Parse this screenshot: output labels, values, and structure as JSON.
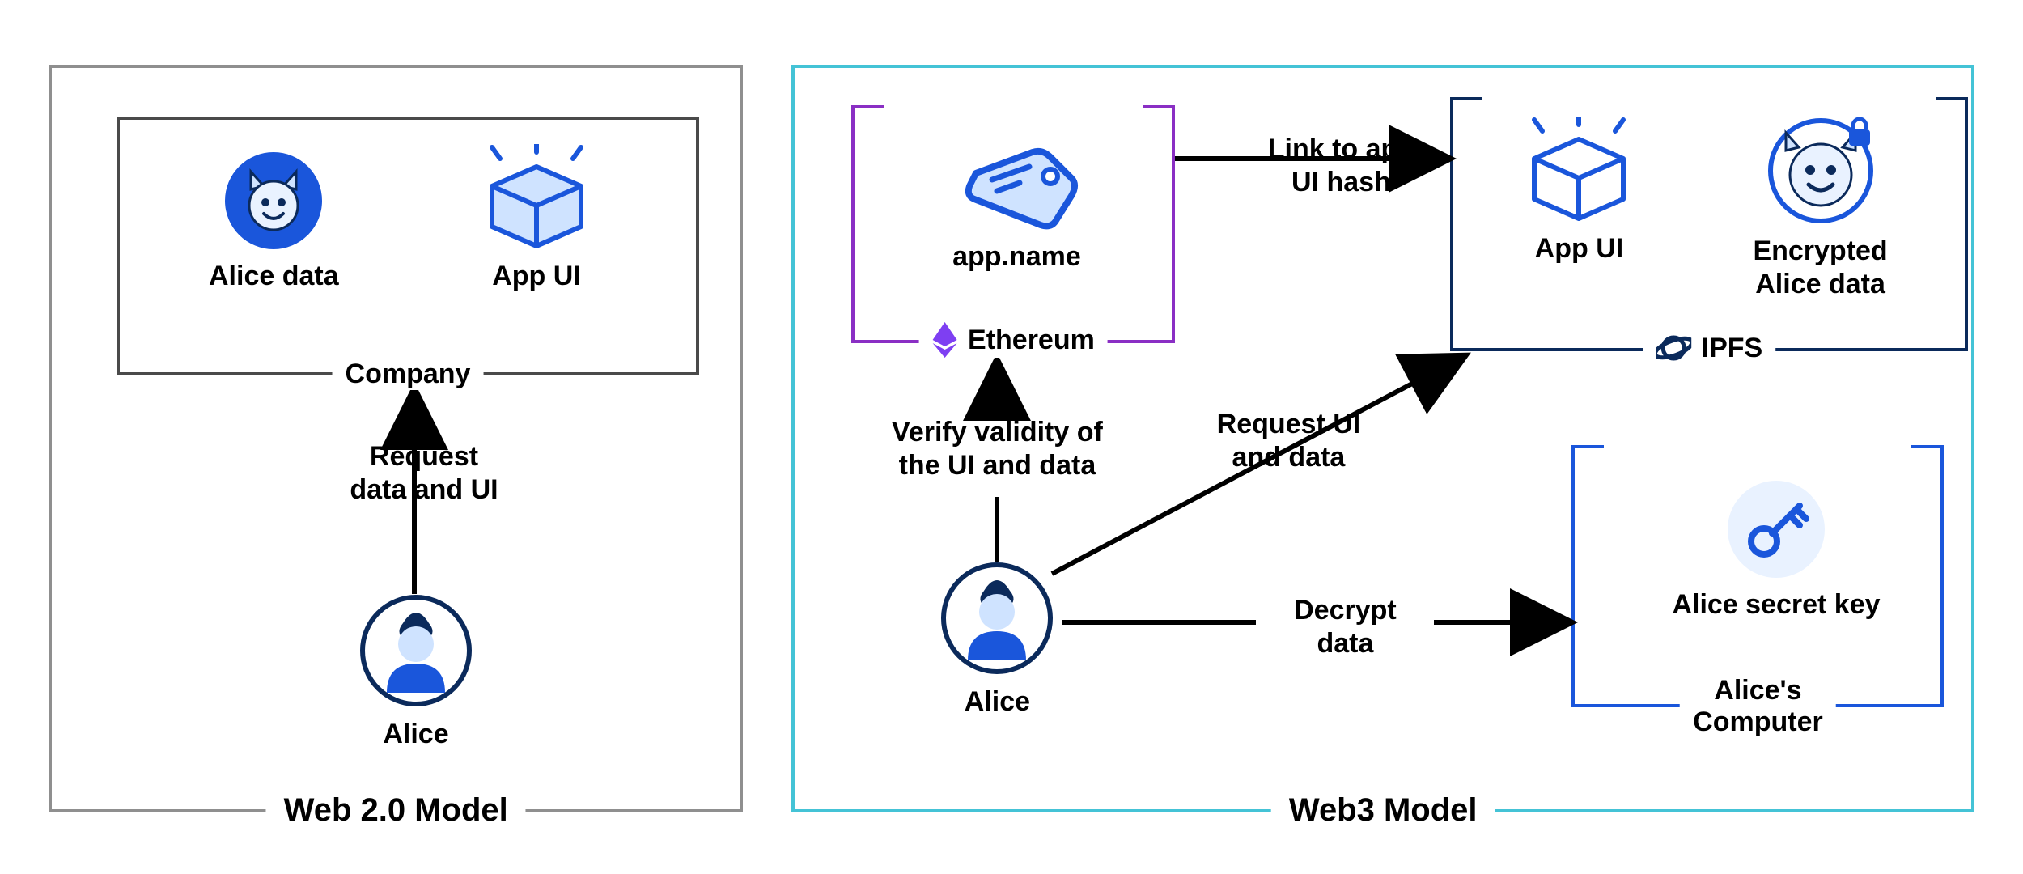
{
  "web2": {
    "title": "Web 2.0 Model",
    "company_label": "Company",
    "alice_data_label": "Alice data",
    "app_ui_label": "App UI",
    "alice_label": "Alice",
    "arrow_request": "Request\ndata and UI"
  },
  "web3": {
    "title": "Web3 Model",
    "ethereum_box_label": "Ethereum",
    "app_name_label": "app.name",
    "ipfs_box_label": "IPFS",
    "app_ui_label": "App UI",
    "encrypted_alice_label": "Encrypted\nAlice data",
    "alice_label": "Alice",
    "alice_computer_label": "Alice's\nComputer",
    "secret_key_label": "Alice secret key",
    "arrow_link": "Link to app\nUI hash",
    "arrow_verify": "Verify validity of\nthe UI and data",
    "arrow_request": "Request UI\nand data",
    "arrow_decrypt": "Decrypt\ndata"
  },
  "colors": {
    "gray": "#8f8f8f",
    "darkgray": "#4a4a4a",
    "cyan": "#44c3d6",
    "purple": "#8a2fc4",
    "navy": "#0b2a5b",
    "blue": "#1a56db",
    "ethPurple": "#7e3ff2"
  }
}
